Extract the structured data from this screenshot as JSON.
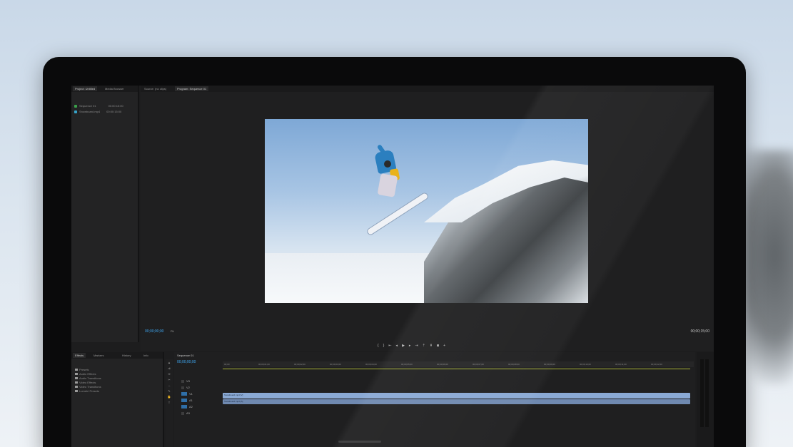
{
  "colors": {
    "accent_timecode": "#3fa9f5",
    "video_clip": "#8aa9d4",
    "audio_clip": "#6f89b0",
    "work_area_bar": "#a9b437",
    "panel_bg": "#232324"
  },
  "panels": {
    "project": {
      "tabs": [
        "Project: Untitled",
        "Media Browser"
      ],
      "items": [
        {
          "name": "Sequence 01",
          "duration": "00:00:15:00",
          "color": "#3aa04a"
        },
        {
          "name": "Snowboard.mp4",
          "duration": "00:00:15:00",
          "color": "#36a3c9"
        }
      ]
    },
    "monitor": {
      "tabs": [
        "Source: (no clips)",
        "Program: Sequence 01"
      ],
      "timecode_current": "00;00;00;00",
      "fit": "Fit",
      "timecode_duration": "00;00;15;00",
      "transport_icons": [
        "mark-in-icon",
        "mark-out-icon",
        "go-to-in-icon",
        "step-back-icon",
        "play-icon",
        "step-forward-icon",
        "go-to-out-icon",
        "lift-icon",
        "extract-icon",
        "export-frame-icon",
        "button-editor-icon"
      ]
    },
    "effects": {
      "tabs": [
        "Effects",
        "Markers",
        "History",
        "Info"
      ],
      "items": [
        "Presets",
        "Audio Effects",
        "Audio Transitions",
        "Video Effects",
        "Video Transitions",
        "Lumetri Presets"
      ]
    },
    "timeline": {
      "tab": "Sequence 01",
      "timecode": "00;00;00;00",
      "ticks": [
        "00;00",
        "00;00;01;00",
        "00;00;02;00",
        "00;00;03;00",
        "00;00;04;00",
        "00;00;05;00",
        "00;00;06;00",
        "00;00;07;00",
        "00;00;08;00",
        "00;00;09;00",
        "00;00;10;00",
        "00;00;11;00",
        "00;00;12;00"
      ],
      "tracks": [
        "V3",
        "V2",
        "V1",
        "A1",
        "A2",
        "A3"
      ],
      "clip_video": "Snowboard.mp4 [V]",
      "clip_audio": "Snowboard.mp4 [A]"
    }
  }
}
